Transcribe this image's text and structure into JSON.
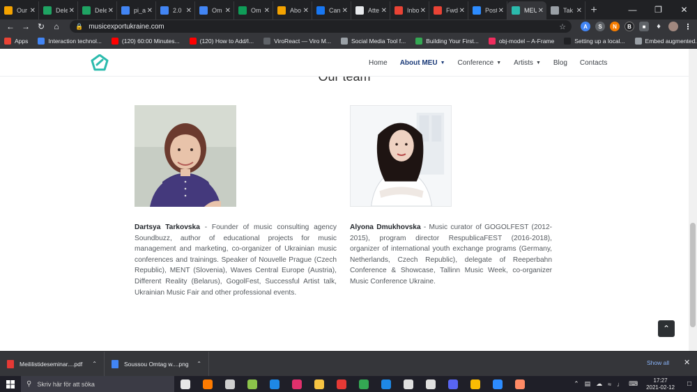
{
  "browser": {
    "tabs": [
      {
        "label": "Our",
        "icon": "app-icon",
        "color": "#f4a300"
      },
      {
        "label": "Dele",
        "icon": "drive-icon",
        "color": "#1fa463"
      },
      {
        "label": "Dele",
        "icon": "drive-icon",
        "color": "#1fa463"
      },
      {
        "label": "pi_a",
        "icon": "docs-icon",
        "color": "#4285f4"
      },
      {
        "label": "2.0",
        "icon": "docs-icon",
        "color": "#4285f4"
      },
      {
        "label": "Om",
        "icon": "docs-icon",
        "color": "#4285f4"
      },
      {
        "label": "Om",
        "icon": "sheets-icon",
        "color": "#0f9d58"
      },
      {
        "label": "Abo",
        "icon": "app-icon",
        "color": "#f4a300"
      },
      {
        "label": "Can",
        "icon": "facebook-icon",
        "color": "#1877f2"
      },
      {
        "label": "Atte",
        "icon": "app-icon",
        "color": "#e8eaed"
      },
      {
        "label": "Inbo",
        "icon": "gmail-icon",
        "color": "#ea4335"
      },
      {
        "label": "Fwd",
        "icon": "gmail-icon",
        "color": "#ea4335"
      },
      {
        "label": "Post",
        "icon": "zoom-icon",
        "color": "#2d8cff"
      },
      {
        "label": "MEU",
        "icon": "meu-icon",
        "color": "#2bbbad",
        "active": true
      },
      {
        "label": "Tak",
        "icon": "globe-icon",
        "color": "#9aa0a6"
      }
    ],
    "url": "musicexportukraine.com",
    "bookmarks": [
      {
        "label": "Apps",
        "icon": "apps-icon",
        "color": "#ea4335"
      },
      {
        "label": "Interaction technol...",
        "icon": "bookmark-icon",
        "color": "#4285f4"
      },
      {
        "label": "(120) 60:00 Minutes...",
        "icon": "youtube-icon",
        "color": "#ff0000"
      },
      {
        "label": "(120) How to Add/I...",
        "icon": "youtube-icon",
        "color": "#ff0000"
      },
      {
        "label": "ViroReact — Viro M...",
        "icon": "viro-icon",
        "color": "#5f6368"
      },
      {
        "label": "Social Media Tool f...",
        "icon": "bookmark-icon",
        "color": "#9aa0a6"
      },
      {
        "label": "Building Your First...",
        "icon": "bookmark-icon",
        "color": "#34a853"
      },
      {
        "label": "obj-model – A-Frame",
        "icon": "aframe-icon",
        "color": "#ef2d5e"
      },
      {
        "label": "Setting up a local...",
        "icon": "bookmark-icon",
        "color": "#202124"
      },
      {
        "label": "Embed augmented...",
        "icon": "bookmark-icon",
        "color": "#9aa0a6"
      }
    ],
    "bookmarks_more": "»"
  },
  "site": {
    "nav": [
      {
        "label": "Home"
      },
      {
        "label": "About MEU",
        "active": true,
        "dropdown": true
      },
      {
        "label": "Conference",
        "dropdown": true
      },
      {
        "label": "Artists",
        "dropdown": true
      },
      {
        "label": "Blog"
      },
      {
        "label": "Contacts"
      }
    ],
    "accent": "#2bbbad",
    "heading": "Our team",
    "members": [
      {
        "name": "Dartsya Tarkovska",
        "bio": " - Founder of music consulting agency Soundbuzz, author of educational projects for music management and marketing, co-organizer of Ukrainian music conferences and trainings. Speaker of Nouvelle Prague (Czech Republic), MENT (Slovenia), Waves Central Europe (Austria), Different Reality (Belarus), GogolFest, Successful Artist talk, Ukrainian Music Fair and other professional events."
      },
      {
        "name": "Alyona Dmukhovska",
        "bio": " - Music curator of GOGOLFEST (2012-2015), program director RespublicaFEST (2016-2018), organizer of international youth exchange programs (Germany, Netherlands, Czech Republic), delegate of Reeperbahn Conference & Showcase, Tallinn Music Week, co-organizer Music Conference Ukraine."
      }
    ]
  },
  "downloads": {
    "items": [
      {
        "name": "Meililistideseminar....pdf",
        "icon": "pdf-icon",
        "color": "#e53935"
      },
      {
        "name": "Soussou Omtag w....png",
        "icon": "image-icon",
        "color": "#4285f4"
      }
    ],
    "show_all": "Show all"
  },
  "taskbar": {
    "search_placeholder": "Skriv här för att söka",
    "apps": [
      {
        "icon": "task-view-icon",
        "color": "#e6e6e6"
      },
      {
        "icon": "fresco-icon",
        "color": "#ff7b00"
      },
      {
        "icon": "camera-icon",
        "color": "#cfcfcf"
      },
      {
        "icon": "game-icon",
        "color": "#8bc34a"
      },
      {
        "icon": "edge-icon",
        "color": "#1e88e5"
      },
      {
        "icon": "instagram-icon",
        "color": "#e1306c"
      },
      {
        "icon": "folder-icon",
        "color": "#f6c342"
      },
      {
        "icon": "acrobat-icon",
        "color": "#e53935"
      },
      {
        "icon": "chrome-icon",
        "color": "#34a853"
      },
      {
        "icon": "mail-icon",
        "color": "#1e88e5"
      },
      {
        "icon": "store-icon",
        "color": "#e0e0e0"
      },
      {
        "icon": "settings-icon",
        "color": "#e0e0e0"
      },
      {
        "icon": "discord-icon",
        "color": "#5865f2"
      },
      {
        "icon": "chrome-alt-icon",
        "color": "#fbbc04"
      },
      {
        "icon": "zoom-icon",
        "color": "#2d8cff"
      },
      {
        "icon": "paint-icon",
        "color": "#ff8a65"
      }
    ],
    "time": "17:27",
    "date": "2021-02-12"
  }
}
